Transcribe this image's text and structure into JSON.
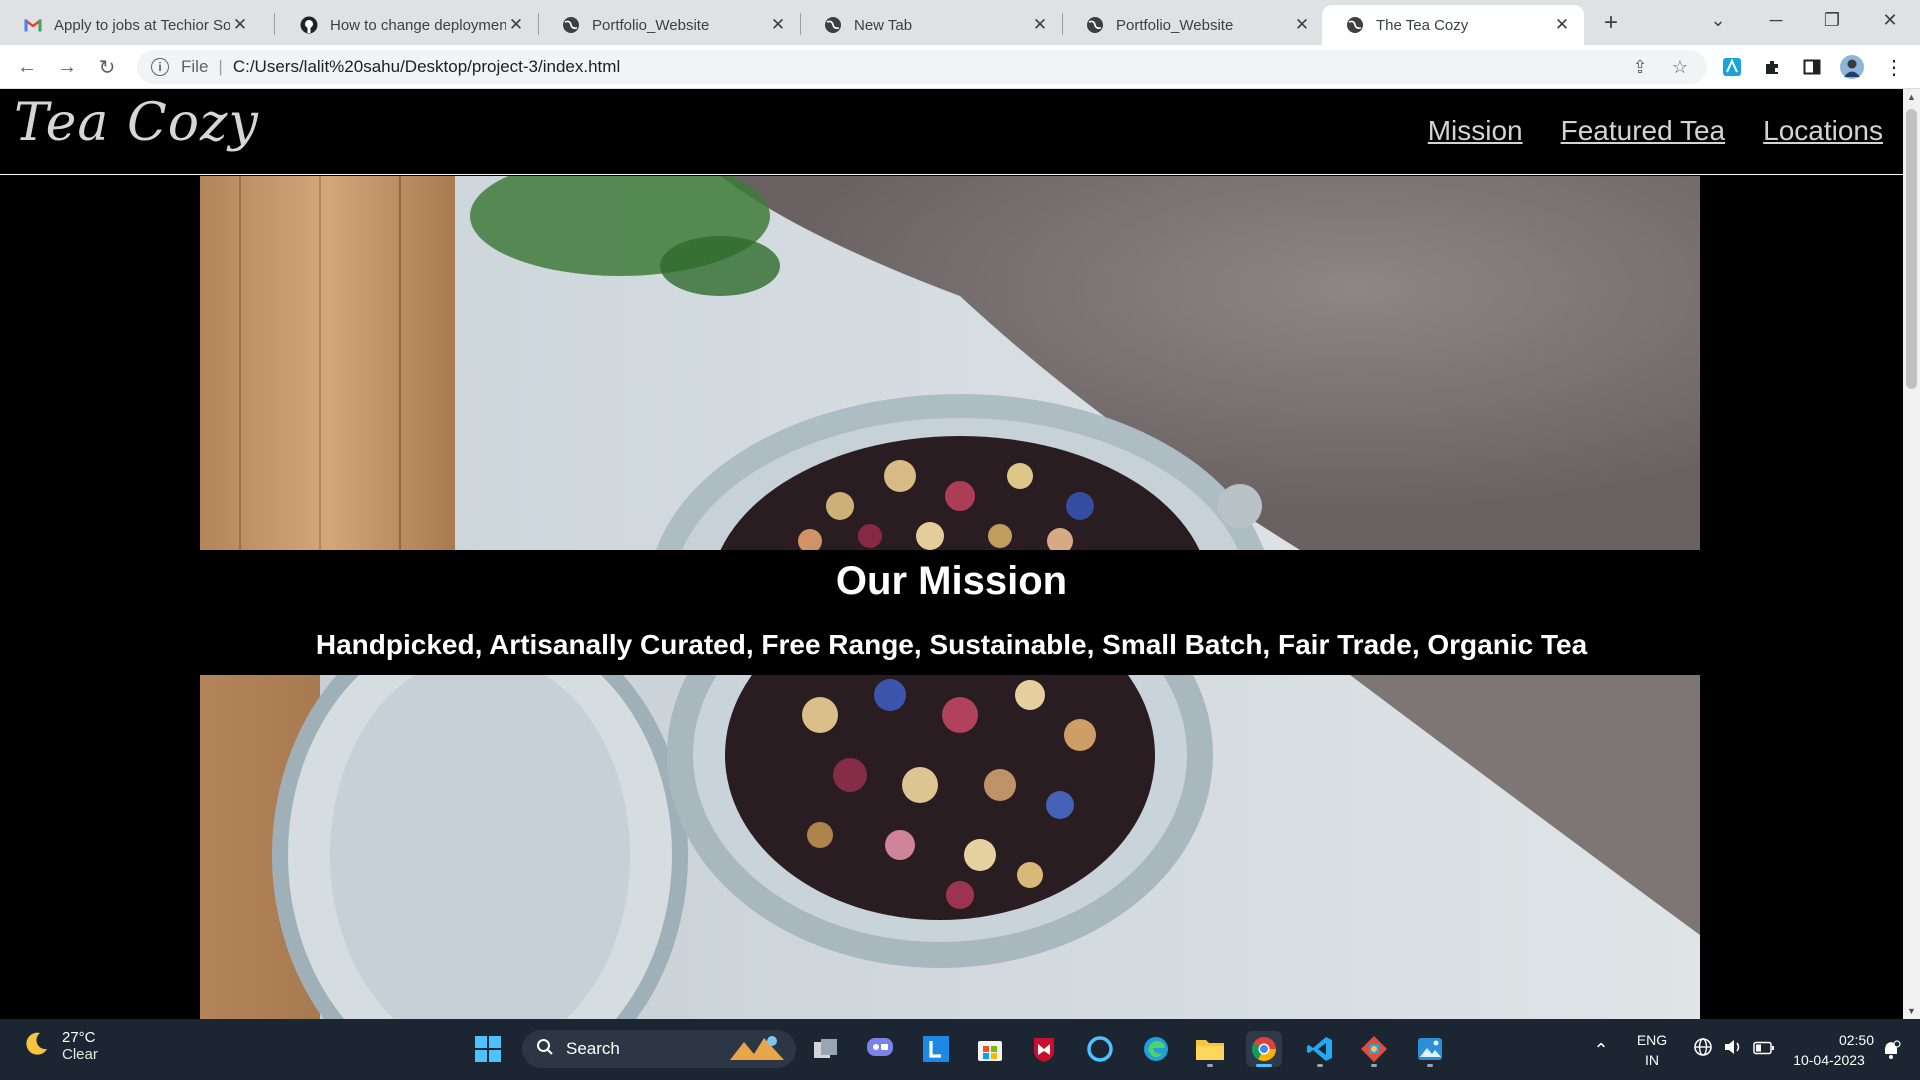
{
  "browser": {
    "tabs": [
      {
        "title": "Apply to jobs at Techior Sol",
        "icon": "gmail-icon",
        "active": false
      },
      {
        "title": "How to change deploymen",
        "icon": "github-icon",
        "active": false
      },
      {
        "title": "Portfolio_Website",
        "icon": "globe-icon",
        "active": false
      },
      {
        "title": "New Tab",
        "icon": "globe-icon",
        "active": false
      },
      {
        "title": "Portfolio_Website",
        "icon": "globe-icon",
        "active": false
      },
      {
        "title": "The Tea Cozy",
        "icon": "globe-icon",
        "active": true
      }
    ],
    "address": {
      "scheme": "File",
      "url": "C:/Users/lalit%20sahu/Desktop/project-3/index.html"
    }
  },
  "site": {
    "logo": "Tea Cozy",
    "nav": [
      "Mission",
      "Featured Tea",
      "Locations"
    ],
    "mission_title": "Our Mission",
    "mission_subtitle": "Handpicked, Artisanally Curated, Free Range, Sustainable, Small Batch, Fair Trade, Organic Tea"
  },
  "taskbar": {
    "weather_temp": "27°C",
    "weather_desc": "Clear",
    "search_label": "Search",
    "lang_top": "ENG",
    "lang_bottom": "IN",
    "time": "02:50",
    "date": "10-04-2023"
  },
  "colors": {
    "page_bg": "#000000",
    "nav_link": "#d4d4d4",
    "taskbar": "#1c2532",
    "tabstrip": "#dfe1e5"
  }
}
